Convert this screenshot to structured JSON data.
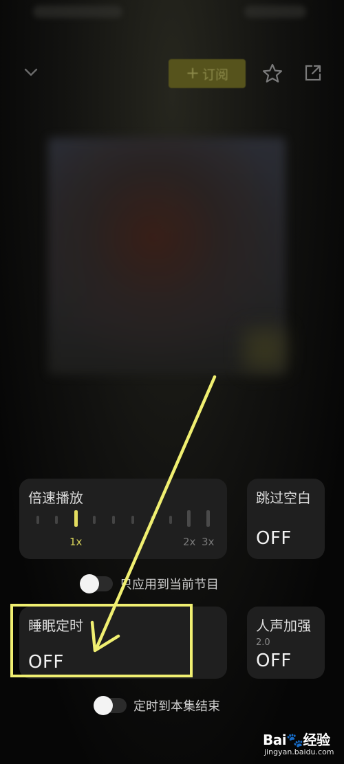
{
  "header": {
    "subscribe_label": "订阅",
    "subscribe_plus": "+"
  },
  "speed_card": {
    "title": "倍速播放",
    "labels": {
      "one": "1x",
      "two": "2x",
      "three": "3x"
    },
    "active_value": "1x"
  },
  "skip_card": {
    "title": "跳过空白",
    "value": "OFF"
  },
  "apply_toggle": {
    "label": "只应用到当前节目",
    "on": false
  },
  "sleep_card": {
    "title": "睡眠定时",
    "value": "OFF"
  },
  "voice_card": {
    "title": "人声加强",
    "version": "2.0",
    "value": "OFF"
  },
  "episode_toggle": {
    "label": "定时到本集结束",
    "on": false
  },
  "annotation": {
    "highlight_color": "#f0ef71",
    "arrow_color": "#f0ef71"
  },
  "watermark": {
    "brand_a": "Bai",
    "brand_b": "du",
    "brand_cn": "经验",
    "url": "jingyan.baidu.com"
  },
  "colors": {
    "accent": "#e3dd60",
    "card_bg": "#1f1f1f",
    "page_bg": "#070707"
  }
}
